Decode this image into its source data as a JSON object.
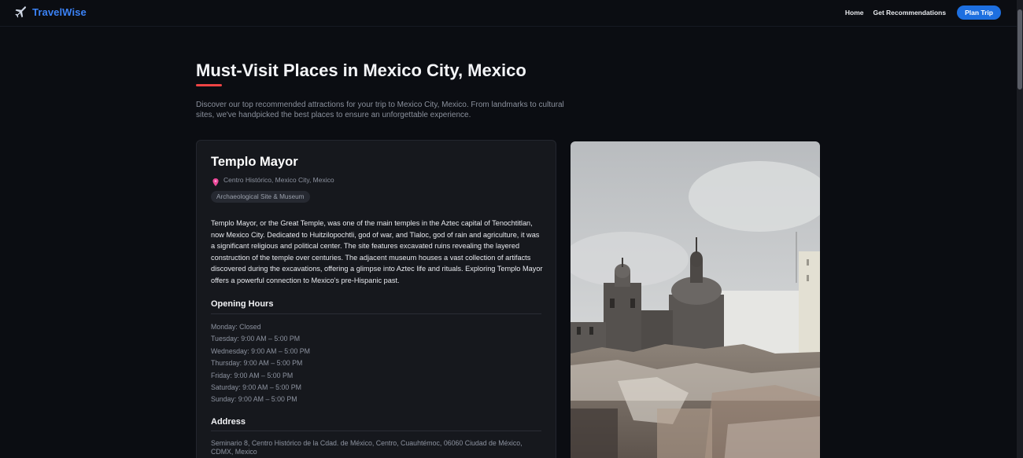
{
  "header": {
    "brand": "TravelWise",
    "nav": {
      "home": "Home",
      "recommendations": "Get Recommendations",
      "plan_trip": "Plan Trip"
    }
  },
  "colors": {
    "accent": "#1d6fe0",
    "brand": "#3b82f6",
    "underline": "#ef4444",
    "background": "#0b0d12",
    "card": "#16181d"
  },
  "main": {
    "title": "Must-Visit Places in Mexico City, Mexico",
    "intro": "Discover our top recommended attractions for your trip to Mexico City, Mexico. From landmarks to cultural sites, we've handpicked the best places to ensure an unforgettable experience."
  },
  "place": {
    "name": "Templo Mayor",
    "location": "Centro Histórico, Mexico City, Mexico",
    "category": "Archaeological Site & Museum",
    "description": "Templo Mayor, or the Great Temple, was one of the main temples in the Aztec capital of Tenochtitlan, now Mexico City. Dedicated to Huitzilopochtli, god of war, and Tlaloc, god of rain and agriculture, it was a significant religious and political center. The site features excavated ruins revealing the layered construction of the temple over centuries. The adjacent museum houses a vast collection of artifacts discovered during the excavations, offering a glimpse into Aztec life and rituals. Exploring Templo Mayor offers a powerful connection to Mexico's pre-Hispanic past.",
    "hours_heading": "Opening Hours",
    "hours": [
      "Monday: Closed",
      "Tuesday: 9:00 AM – 5:00 PM",
      "Wednesday: 9:00 AM – 5:00 PM",
      "Thursday: 9:00 AM – 5:00 PM",
      "Friday: 9:00 AM – 5:00 PM",
      "Saturday: 9:00 AM – 5:00 PM",
      "Sunday: 9:00 AM – 5:00 PM"
    ],
    "address_heading": "Address",
    "address": "Seminario 8, Centro Histórico de la Cdad. de México, Centro, Cuauhtémoc, 06060 Ciudad de México, CDMX, Mexico"
  },
  "icons": {
    "brand": "airplane-icon",
    "location": "map-pin-icon"
  }
}
